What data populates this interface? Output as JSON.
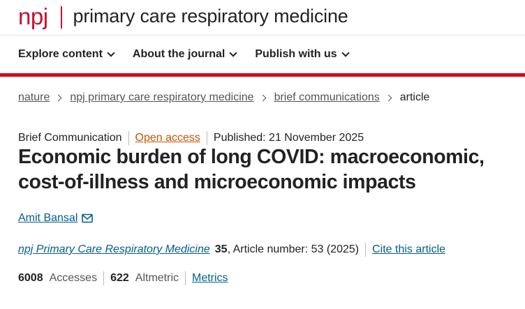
{
  "header": {
    "logo": "npj",
    "journal_title": "primary care respiratory medicine"
  },
  "nav": {
    "items": [
      {
        "label": "Explore content"
      },
      {
        "label": "About the journal"
      },
      {
        "label": "Publish with us"
      }
    ]
  },
  "breadcrumb": {
    "items": [
      "nature",
      "npj primary care respiratory medicine",
      "brief communications"
    ],
    "current": "article"
  },
  "article": {
    "type": "Brief Communication",
    "access": "Open access",
    "published": "Published: 21 November 2025",
    "title": "Economic burden of long COVID: macroeconomic, cost-of-illness and microeconomic impacts",
    "author": "Amit Bansal",
    "journal_name": "npj Primary Care Respiratory Medicine",
    "volume": "35",
    "article_number": ", Article number: 53 (2025)",
    "cite_label": "Cite this article"
  },
  "metrics": {
    "accesses_value": "6008",
    "accesses_label": "Accesses",
    "altmetric_value": "622",
    "altmetric_label": "Altmetric",
    "metrics_link": "Metrics"
  },
  "colors": {
    "brand_red": "#c8102e",
    "link_blue": "#025e8d",
    "open_access_orange": "#c65301"
  },
  "icons": {
    "author_contact": "envelope-icon",
    "nav_dropdown": "chevron-down-icon",
    "breadcrumb_separator": "chevron-right-icon"
  }
}
